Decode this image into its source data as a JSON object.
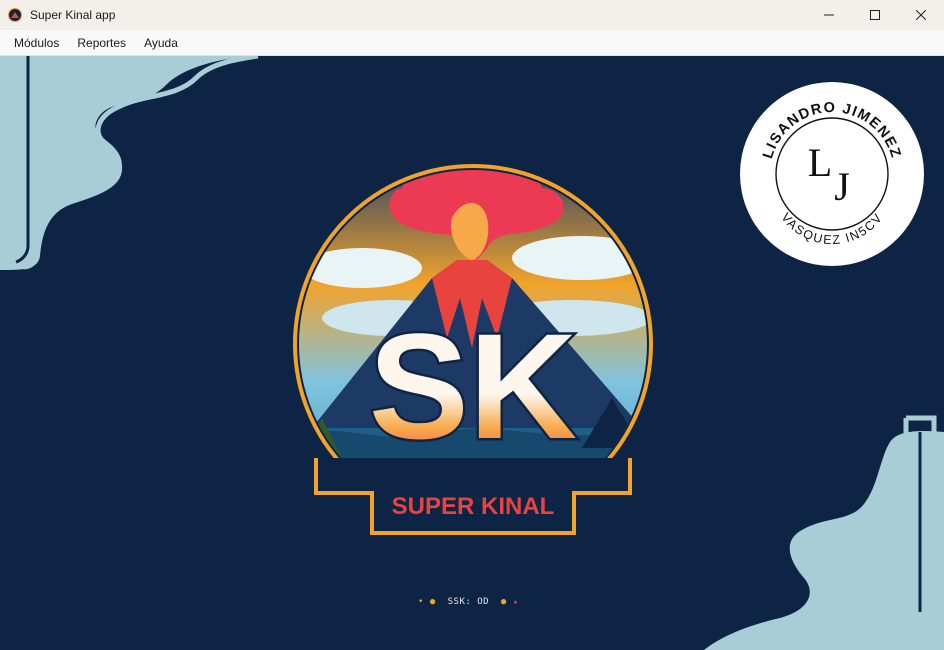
{
  "window": {
    "title": "Super Kinal app",
    "controls": {
      "minimize": "—",
      "maximize": "☐",
      "close": "✕"
    }
  },
  "menu": {
    "items": [
      {
        "label": "Módulos"
      },
      {
        "label": "Reportes"
      },
      {
        "label": "Ayuda"
      }
    ]
  },
  "badge": {
    "top_text": "LISANDRO JIMENEZ",
    "bottom_text": "VASQUEZ IN5CV",
    "initials": "LJ",
    "initial_1": "L",
    "initial_2": "J"
  },
  "logo": {
    "letters": "SK",
    "letter_1": "S",
    "letter_2": "K",
    "brand": "SUPER KINAL",
    "caption": "SSK: OD"
  },
  "colors": {
    "background": "#0e2444",
    "accent_light_blue": "#a9cdd6",
    "flame_red": "#e8433f",
    "gold": "#f2a32b"
  }
}
